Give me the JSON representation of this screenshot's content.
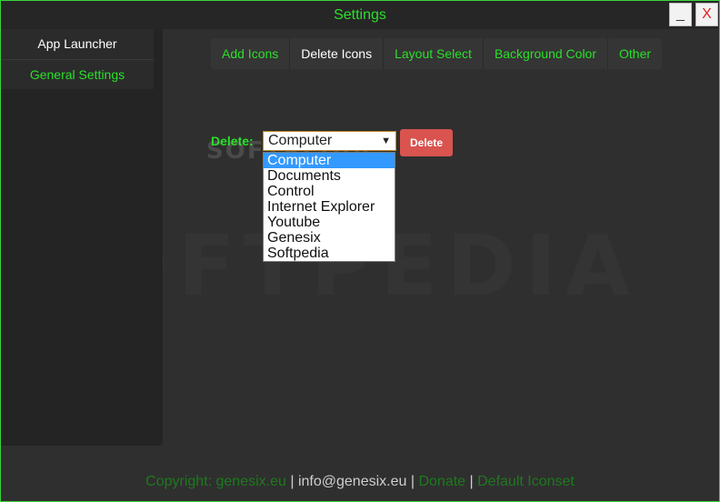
{
  "window": {
    "title": "Settings",
    "minimize_label": "_",
    "close_label": "X"
  },
  "sidebar": {
    "items": [
      {
        "label": "App Launcher"
      },
      {
        "label": "General Settings"
      }
    ]
  },
  "tabs": [
    {
      "label": "Add Icons"
    },
    {
      "label": "Delete Icons"
    },
    {
      "label": "Layout Select"
    },
    {
      "label": "Background Color"
    },
    {
      "label": "Other"
    }
  ],
  "delete_form": {
    "label": "Delete:",
    "selected_value": "Computer",
    "button_label": "Delete",
    "options": [
      "Computer",
      "Documents",
      "Control",
      "Internet Explorer",
      "Youtube",
      "Genesix",
      "Softpedia"
    ]
  },
  "watermark": {
    "big": "SOFTPEDIA",
    "small": "SOFTPEDIA"
  },
  "footer": {
    "copyright": "Copyright: genesix.eu",
    "sep1": "|",
    "email": "info@genesix.eu",
    "sep2": "|",
    "donate": "Donate",
    "sep3": "|",
    "default_iconset": "Default Iconset"
  },
  "colors": {
    "accent_green": "#2ae02a",
    "delete_red": "#d9534f",
    "selection_blue": "#3399ff"
  }
}
